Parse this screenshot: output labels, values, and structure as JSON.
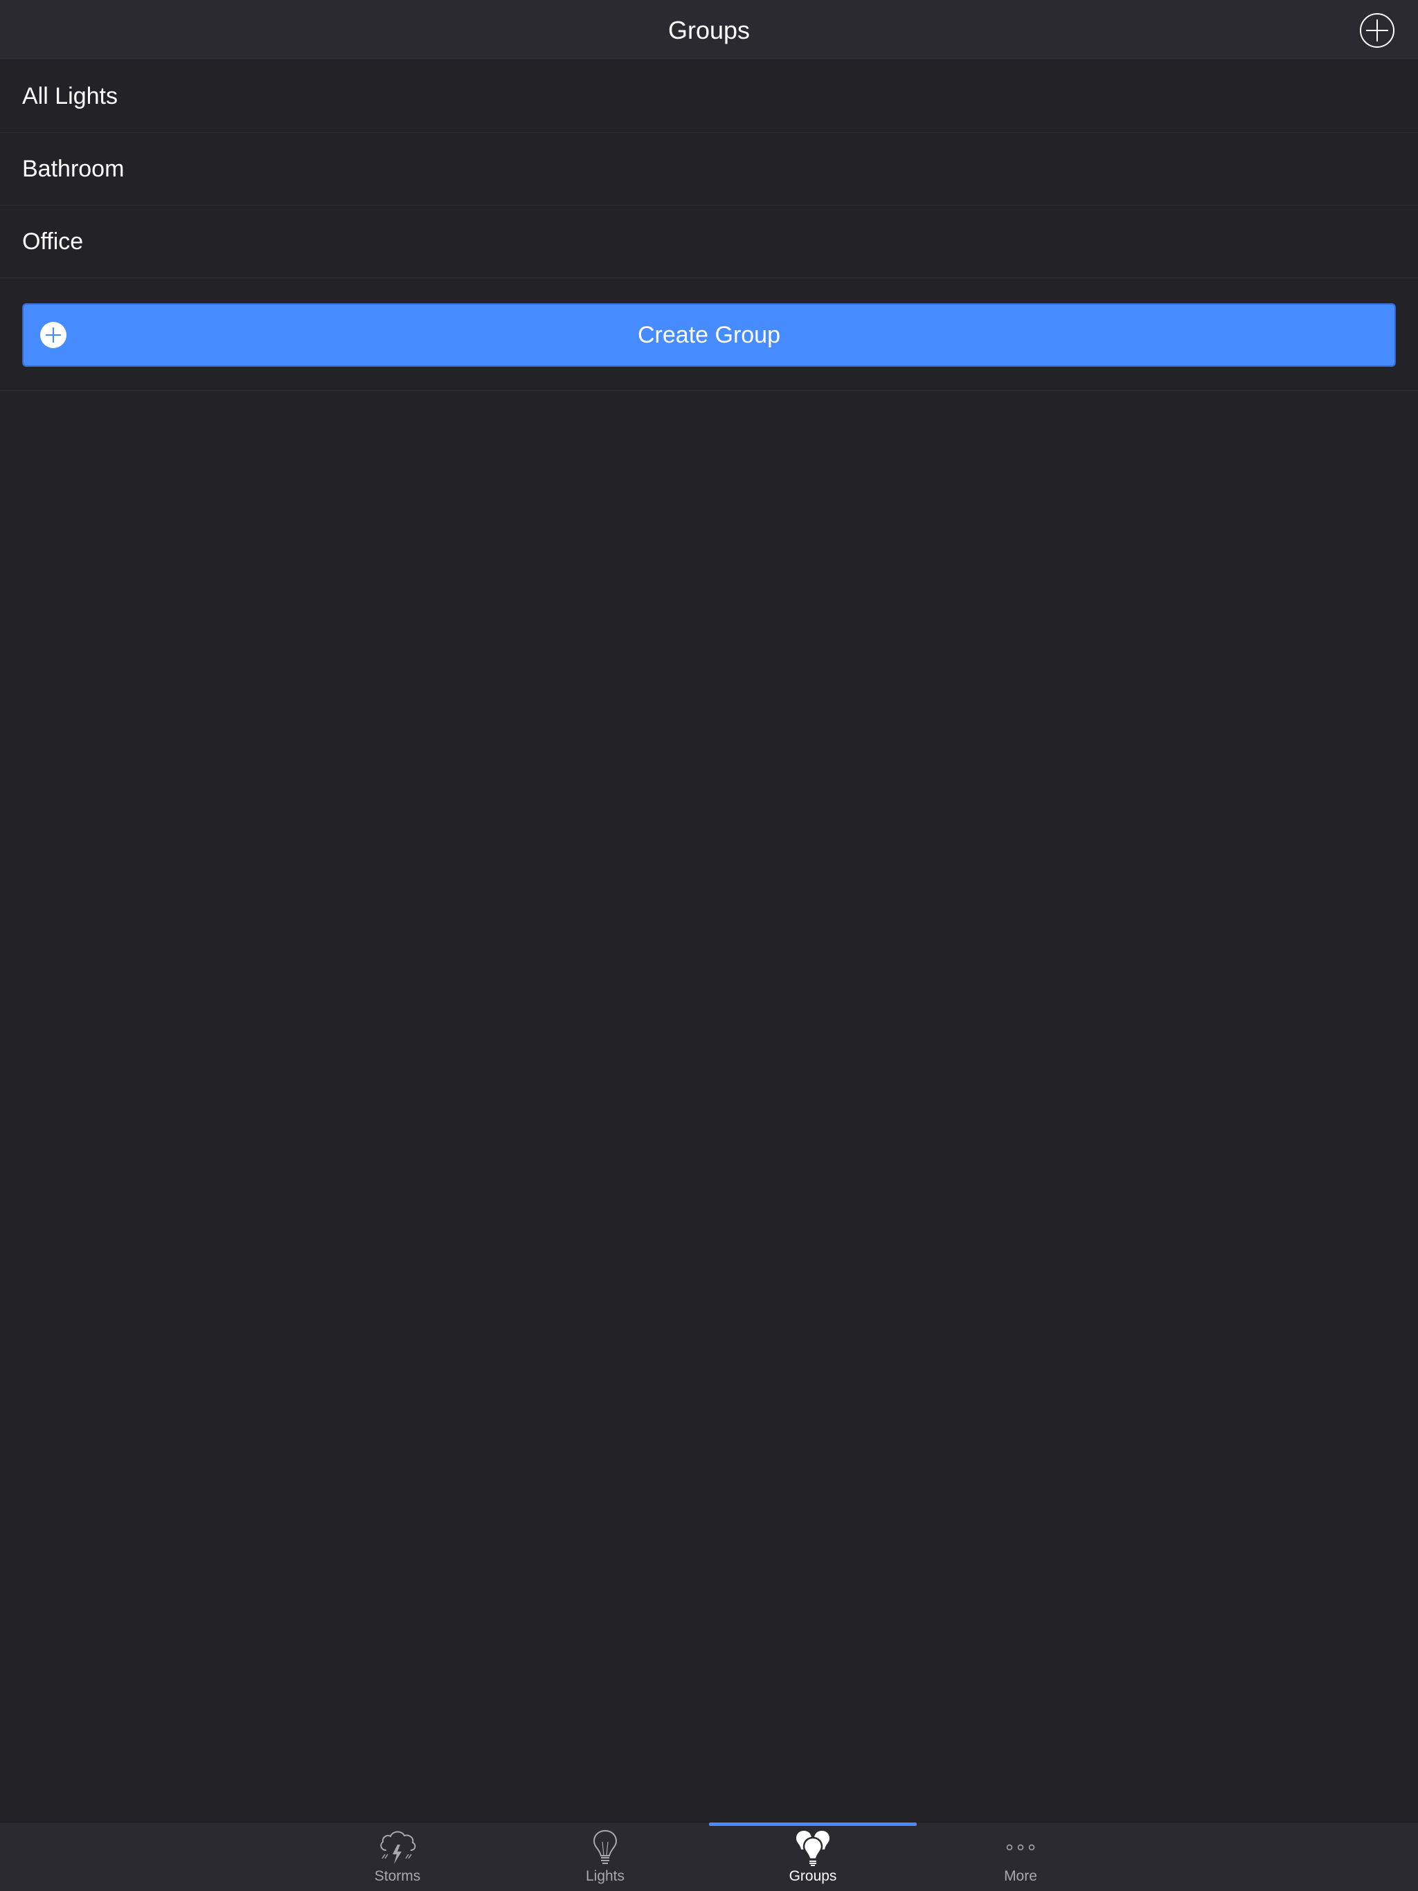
{
  "header": {
    "title": "Groups",
    "add_icon": "plus-circle-icon"
  },
  "groups": [
    {
      "label": "All Lights"
    },
    {
      "label": "Bathroom"
    },
    {
      "label": "Office"
    }
  ],
  "create_group": {
    "label": "Create Group",
    "icon": "plus-circle-icon"
  },
  "tabbar": {
    "active": "Groups",
    "tabs": [
      {
        "label": "Storms",
        "icon": "storm-cloud-icon"
      },
      {
        "label": "Lights",
        "icon": "lightbulb-icon"
      },
      {
        "label": "Groups",
        "icon": "multiple-bulbs-icon"
      },
      {
        "label": "More",
        "icon": "more-dots-icon"
      }
    ]
  },
  "colors": {
    "background": "#222227",
    "header": "#2a2a30",
    "accent": "#468bff",
    "tab_inactive": "#a9a9ad",
    "text": "#ffffff"
  }
}
